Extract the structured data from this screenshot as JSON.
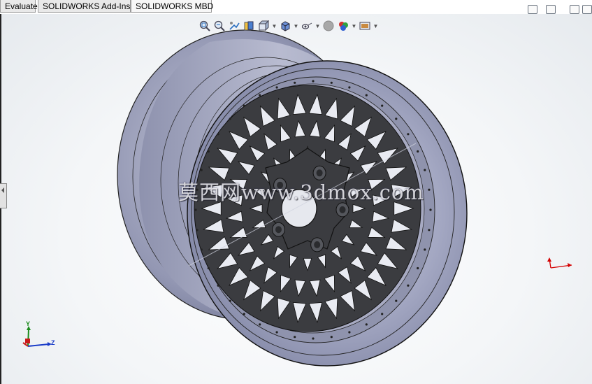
{
  "tabs": [
    {
      "label": "Evaluate"
    },
    {
      "label": "SOLIDWORKS Add-Ins"
    },
    {
      "label": "SOLIDWORKS MBD"
    }
  ],
  "heads_up_toolbar": [
    "zoom-to-fit-icon",
    "zoom-to-area-icon",
    "previous-view-icon",
    "section-view-icon",
    "view-orientation-icon",
    "display-style-icon",
    "hide-show-items-icon",
    "edit-appearance-icon",
    "apply-scene-icon",
    "view-settings-icon"
  ],
  "watermark": "莫西网www.3dmox.com",
  "triad": {
    "y": "Y",
    "z": "Z"
  },
  "colors": {
    "rim": "#9ea3c0",
    "spokes": "#3b3c40",
    "background": "#f2f4f6"
  }
}
